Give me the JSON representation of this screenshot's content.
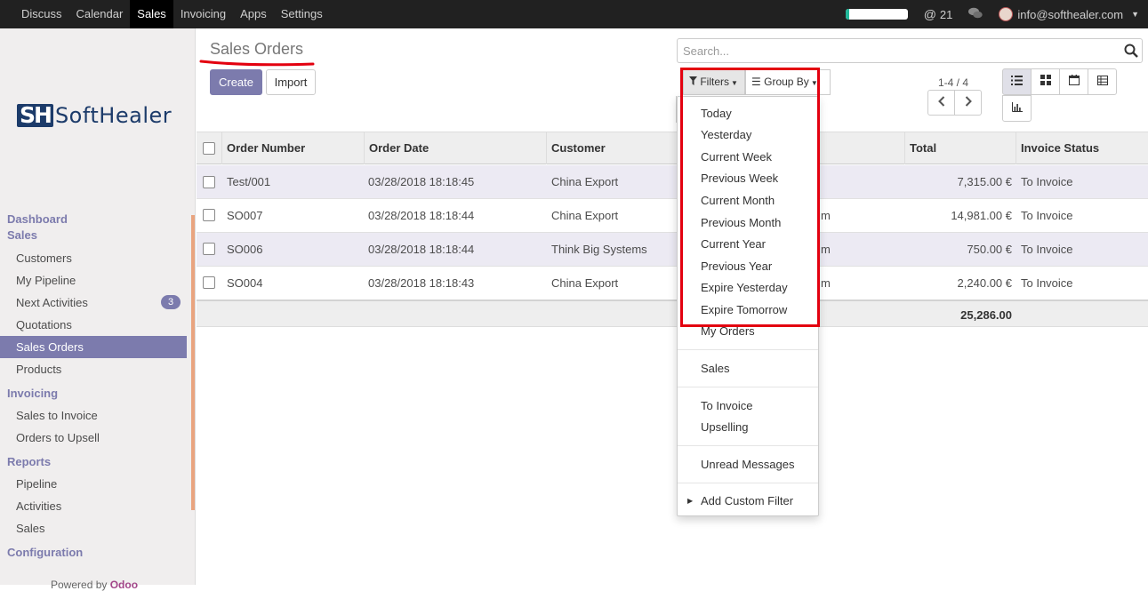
{
  "topbar": {
    "apps": [
      "Discuss",
      "Calendar",
      "Sales",
      "Invoicing",
      "Apps",
      "Settings"
    ],
    "active_app": "Sales",
    "notification_count": "21",
    "user_email": "info@softhealer.com"
  },
  "sidebar": {
    "logo_mark": "SH",
    "logo_text": "SoftHealer",
    "sections": [
      {
        "title": "Dashboard"
      },
      {
        "title": "Sales",
        "items": [
          "Customers",
          "My Pipeline",
          "Next Activities",
          "Quotations",
          "Sales Orders",
          "Products"
        ]
      },
      {
        "title": "Invoicing",
        "items": [
          "Sales to Invoice",
          "Orders to Upsell"
        ]
      },
      {
        "title": "Reports",
        "items": [
          "Pipeline",
          "Activities",
          "Sales"
        ]
      },
      {
        "title": "Configuration"
      }
    ],
    "next_activities_badge": "3",
    "active_item": "Sales Orders",
    "powered_by": "Powered by",
    "powered_brand": "Odoo"
  },
  "page": {
    "title": "Sales Orders",
    "create_label": "Create",
    "import_label": "Import",
    "search_placeholder": "Search...",
    "filters_label": "Filters",
    "group_by_label": "Group By",
    "pager": "1-4 / 4"
  },
  "table": {
    "columns": [
      "Order Number",
      "Order Date",
      "Customer",
      "Total",
      "Invoice Status"
    ],
    "rows": [
      {
        "number": "Test/001",
        "date": "03/28/2018 18:18:45",
        "customer": "China Export",
        "hidden": "",
        "total": "7,315.00 €",
        "status": "To Invoice"
      },
      {
        "number": "SO007",
        "date": "03/28/2018 18:18:44",
        "customer": "China Export",
        "hidden": "m",
        "total": "14,981.00 €",
        "status": "To Invoice"
      },
      {
        "number": "SO006",
        "date": "03/28/2018 18:18:44",
        "customer": "Think Big Systems",
        "hidden": "m",
        "total": "750.00 €",
        "status": "To Invoice"
      },
      {
        "number": "SO004",
        "date": "03/28/2018 18:18:43",
        "customer": "China Export",
        "hidden": "m",
        "total": "2,240.00 €",
        "status": "To Invoice"
      }
    ],
    "sum_total": "25,286.00"
  },
  "filters_menu": {
    "date_filters": [
      "Today",
      "Yesterday",
      "Current Week",
      "Previous Week",
      "Current Month",
      "Previous Month",
      "Current Year",
      "Previous Year",
      "Expire Yesterday",
      "Expire Tomorrow"
    ],
    "my_orders": "My Orders",
    "sales": "Sales",
    "to_invoice": "To Invoice",
    "upselling": "Upselling",
    "unread": "Unread Messages",
    "custom": "Add Custom Filter"
  },
  "colors": {
    "accent": "#7c7bad",
    "highlight": "#e3000f",
    "topbar": "#212121"
  }
}
